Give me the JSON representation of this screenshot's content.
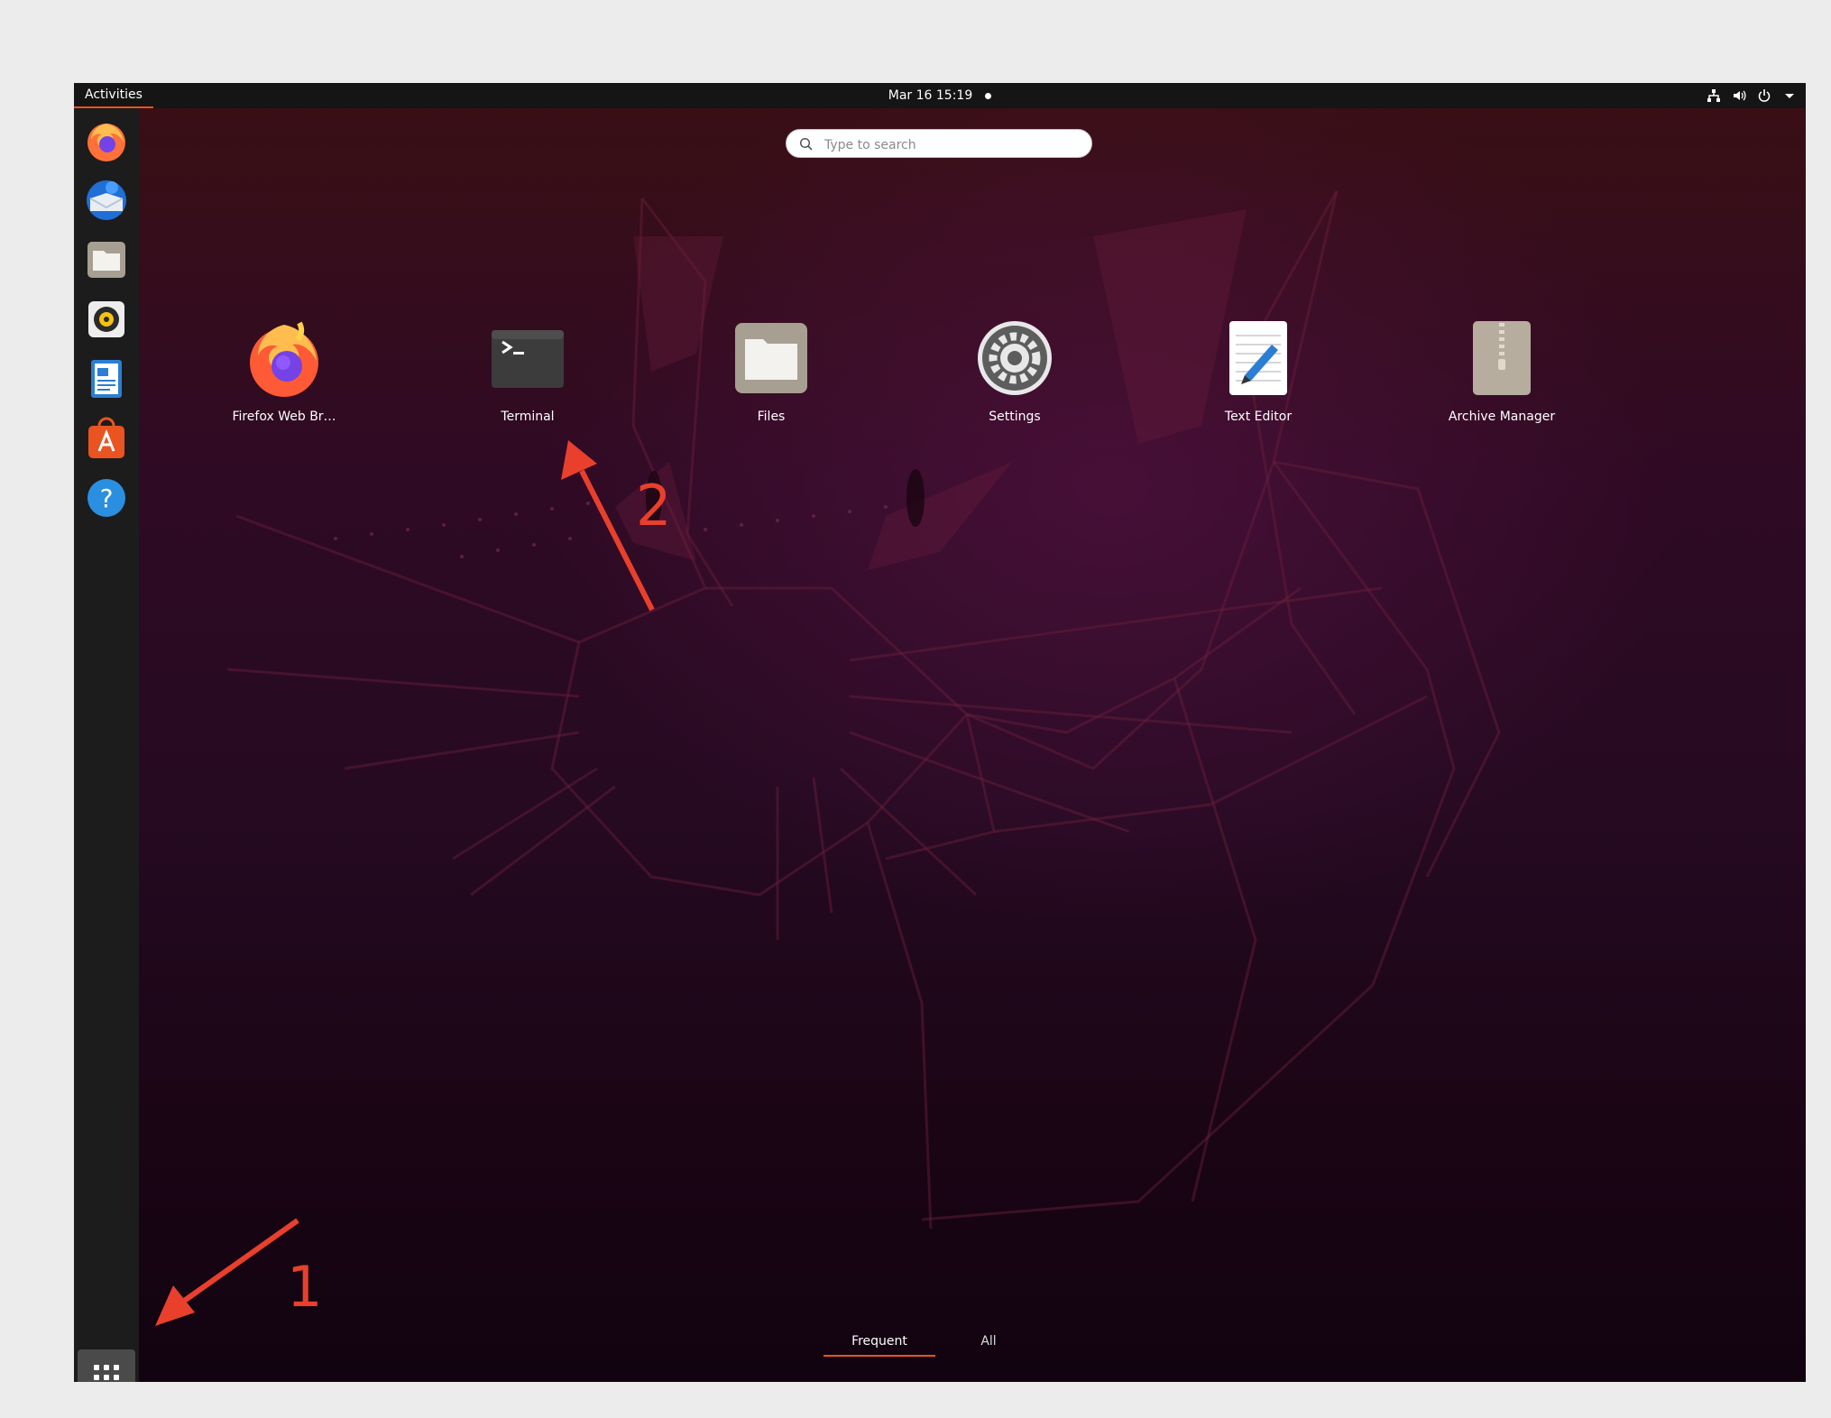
{
  "topbar": {
    "activities": "Activities",
    "clock": "Mar 16  15:19",
    "system_icons": [
      "network-icon",
      "volume-icon",
      "power-icon",
      "menu-caret-icon"
    ]
  },
  "dock": {
    "items": [
      {
        "name": "firefox",
        "icon": "firefox-icon"
      },
      {
        "name": "thunderbird",
        "icon": "thunderbird-icon"
      },
      {
        "name": "files",
        "icon": "folder-icon"
      },
      {
        "name": "rhythmbox",
        "icon": "speaker-icon"
      },
      {
        "name": "libreoffice-writer",
        "icon": "writer-document-icon"
      },
      {
        "name": "ubuntu-software",
        "icon": "software-bag-icon"
      },
      {
        "name": "help",
        "icon": "help-icon"
      }
    ],
    "show_applications_icon": "grid-icon"
  },
  "search": {
    "placeholder": "Type to search"
  },
  "apps": [
    {
      "label": "Firefox Web Br…",
      "icon": "firefox-icon"
    },
    {
      "label": "Terminal",
      "icon": "terminal-icon"
    },
    {
      "label": "Files",
      "icon": "folder-icon"
    },
    {
      "label": "Settings",
      "icon": "settings-gear-icon"
    },
    {
      "label": "Text Editor",
      "icon": "text-editor-icon"
    },
    {
      "label": "Archive Manager",
      "icon": "archive-zip-icon"
    }
  ],
  "tabs": {
    "frequent": "Frequent",
    "all": "All"
  },
  "annotations": {
    "arrow1_label": "1",
    "arrow2_label": "2",
    "color": "#e8402c"
  },
  "colors": {
    "accent": "#e95420",
    "dock": "#1c1c1c",
    "topbar": "#151515"
  }
}
